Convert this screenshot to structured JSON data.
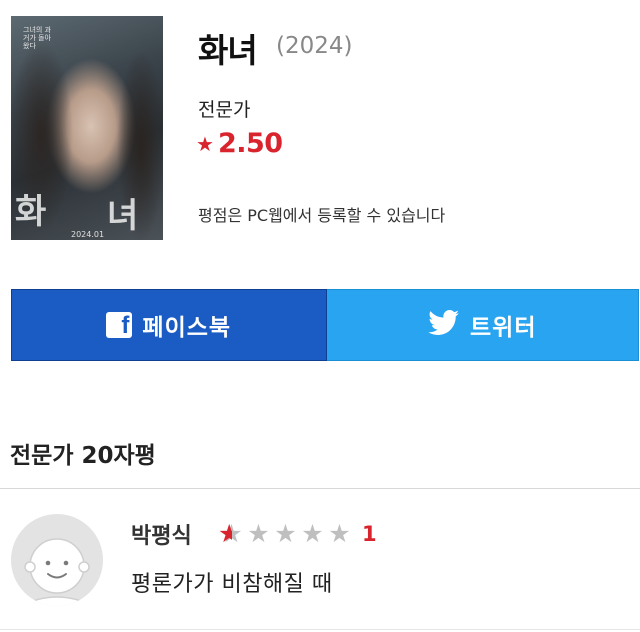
{
  "movie": {
    "title": "화녀",
    "year": "(2024)",
    "poster_title_left": "화",
    "poster_title_right": "녀",
    "poster_date": "2024.01",
    "poster_tagline": "그녀의 과거가 돌아왔다"
  },
  "rating": {
    "label": "전문가",
    "value": "2.50",
    "star_color": "#d9232d",
    "notice": "평점은 PC웹에서 등록할 수 있습니다"
  },
  "share": {
    "facebook_label": "페이스북",
    "facebook_color": "#1a5bc4",
    "twitter_label": "트위터",
    "twitter_color": "#28a4f0"
  },
  "section": {
    "title": "전문가 20자평"
  },
  "reviews": [
    {
      "reviewer": "박평식",
      "rating": 1,
      "rating_max": 10,
      "score_text": "1",
      "comment": "평론가가 비참해질 때"
    }
  ]
}
